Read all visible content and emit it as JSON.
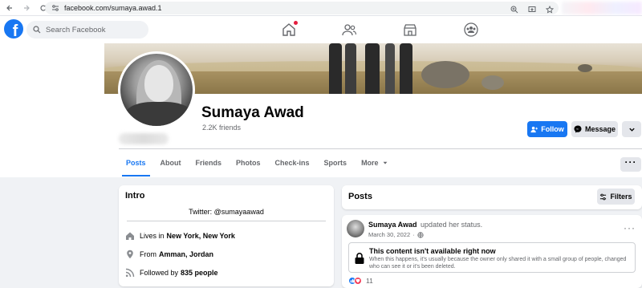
{
  "browser": {
    "url": "facebook.com/sumaya.awad.1"
  },
  "fb_nav": {
    "search_placeholder": "Search Facebook"
  },
  "profile": {
    "name": "Sumaya Awad",
    "friends": "2.2K friends"
  },
  "actions": {
    "follow": "Follow",
    "message": "Message"
  },
  "tabs": [
    "Posts",
    "About",
    "Friends",
    "Photos",
    "Check-ins",
    "Sports",
    "More"
  ],
  "intro": {
    "title": "Intro",
    "bio": "Twitter: @sumayaawad",
    "lives_prefix": "Lives in",
    "lives_value": "New York, New York",
    "from_prefix": "From",
    "from_value": "Amman, Jordan",
    "followed_prefix": "Followed by",
    "followed_value": "835 people"
  },
  "posts": {
    "title": "Posts",
    "filters": "Filters"
  },
  "post": {
    "author": "Sumaya Awad",
    "action": "updated her status.",
    "date": "March 30, 2022",
    "unavailable_title": "This content isn't available right now",
    "unavailable_body": "When this happens, it's usually because the owner only shared it with a small group of people, changed who can see it or it's been deleted.",
    "reaction_count": "11"
  },
  "colors": {
    "brand": "#1877f2",
    "background": "#f0f2f5",
    "secondary_text": "#65676b"
  }
}
